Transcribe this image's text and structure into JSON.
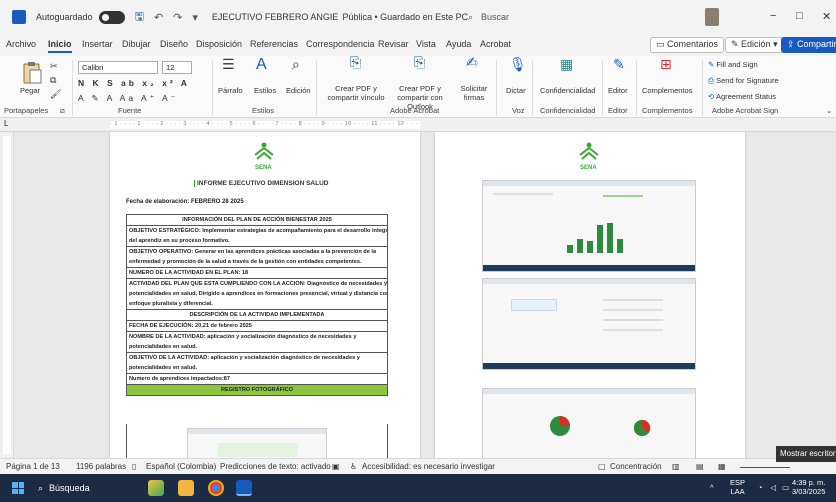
{
  "titlebar": {
    "autosave_label": "Autoguardado",
    "doc_title": "EJECUTIVO FEBRERO ANGIE",
    "doc_status": "Pública • Guardado en Este PC",
    "search_placeholder": "Buscar",
    "minimize": "−",
    "restore": "□",
    "close": "✕"
  },
  "menu": {
    "tabs": [
      "Archivo",
      "Inicio",
      "Insertar",
      "Dibujar",
      "Diseño",
      "Disposición",
      "Referencias",
      "Correspondencia",
      "Revisar",
      "Vista",
      "Ayuda",
      "Acrobat"
    ],
    "comments": "Comentarios",
    "editing": "Edición",
    "share": "Compartir"
  },
  "ribbon": {
    "paste": "Pegar",
    "clipboard_group": "Portapapeles",
    "font_name": "Calibri",
    "font_size": "12",
    "font_group": "Fuente",
    "paragraph": "Párrafo",
    "styles": "Estilos",
    "styles_group": "Estilos",
    "editing": "Edición",
    "create_pdf_link": "Crear PDF y compartir vínculo",
    "create_pdf_outlook": "Crear PDF y compartir con Outlook",
    "request_signatures": "Solicitar firmas",
    "acrobat_group": "Adobe Acrobat",
    "dictate": "Dictar",
    "voice_group": "Voz",
    "confidentiality": "Confidencialidad",
    "confidentiality_group": "Confidencialidad",
    "editor": "Editor",
    "editor_group": "Editor",
    "add_ins": "Complementos",
    "add_ins_group": "Complementos",
    "fill_sign": "Fill and Sign",
    "send_signature": "Send for Signature",
    "agreement_status": "Agreement Status",
    "sign_group": "Adobe Acrobat Sign"
  },
  "ruler_text": "· 1 · · · · 1 · · · · 2 · · · · 3 · · · · 4 · · · · 5 · · · · 6 · · · · 7 · · · · 8 · · · · 9 · · · · 10 · · · · 11 · · · · 12 · · · · 13 · · · · 14 · · · · 15 · · · ·",
  "document": {
    "logo": "SENA",
    "title": "INFORME EJECUTIVO DIMENSION SALUD",
    "date_line": "Fecha de elaboración: FEBRERO 28 2025",
    "rows": [
      "INFORMACIÓN DEL PLAN DE ACCIÓN BIENESTAR 2025",
      "OBJETIVO ESTRATÉGICO: Implementar estrategias de acompañamiento para el desarrollo integral",
      "del aprendiz en su proceso formativo.",
      "OBJETIVO OPERATIVO: Generar en las aprendices prácticas asociadas a la prevención de la",
      "enfermedad y promoción de la salud a través de la gestión con entidades competentes.",
      "NUMERO DE LA ACTIVIDAD EN EL PLAN: 18",
      "ACTIVIDAD DEL PLAN QUE ESTA CUMPLIENDO CON LA ACCION: Diagnóstico de necesidades y",
      "potencialidades en salud, Dirigido a aprendices en formaciones presencial, virtual y distancia con",
      "enfoque pluralista y diferencial.",
      "DESCRIPCIÓN DE LA ACTIVIDAD IMPLEMENTADA",
      "FECHA DE EJECUCIÓN:  20,21 de febrero 2025",
      "NOMBRE DE LA ACTIVIDAD: aplicación y socialización diagnóstico de necesidades y",
      "potencialidades en salud.",
      "OBJETIVO DE LA ACTIVIDAD: aplicación y socialización diagnóstico de necesidades y",
      "potencialidades en salud.",
      "Numero de aprendices impactados:87",
      "REGISTRO FOTOGRÁFICO"
    ]
  },
  "statusbar": {
    "page": "Página 1 de 13",
    "words": "1196 palabras",
    "language": "Español (Colombia)",
    "prediction": "Predicciones de texto: activado",
    "accessibility": "Accesibilidad: es necesario investigar",
    "focus": "Concentración",
    "tooltip": "Mostrar escritorio"
  },
  "taskbar": {
    "search": "Búsqueda",
    "lang_top": "ESP",
    "lang_bottom": "LAA",
    "time": "4:39 p. m.",
    "date": "3/03/2025"
  },
  "colors": {
    "word_blue": "#185abd",
    "sena_green": "#39a935",
    "table_green": "#8cc63f",
    "taskbar": "#1b2b44"
  }
}
